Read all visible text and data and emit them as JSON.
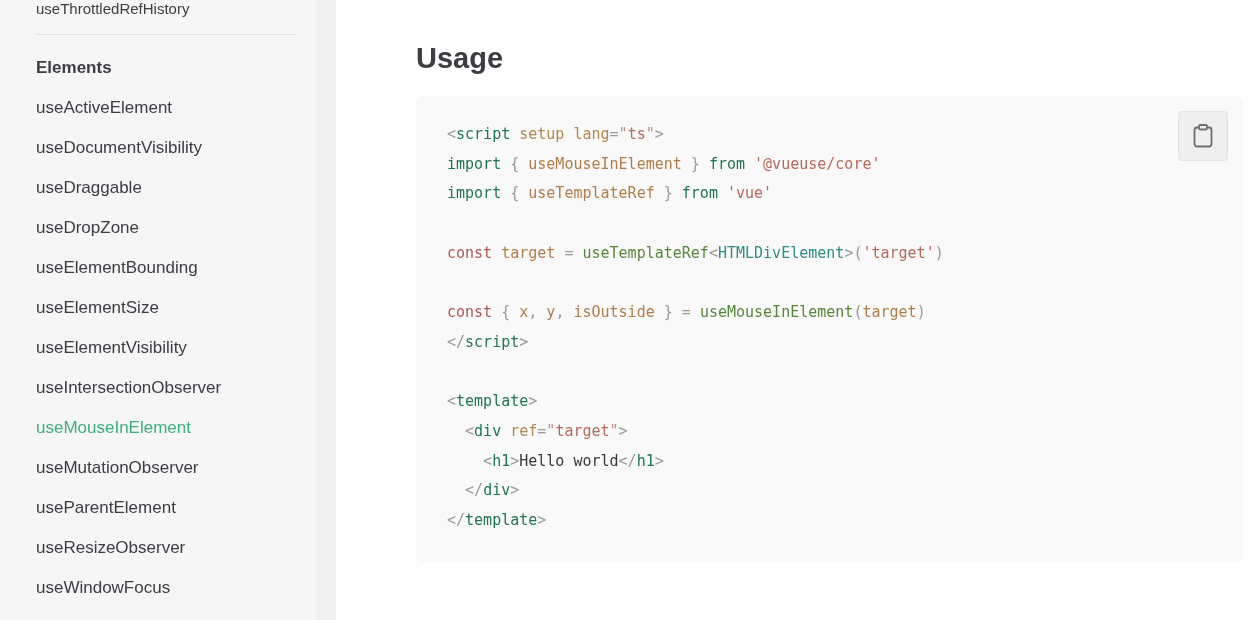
{
  "sidebar": {
    "cut_item": "useThrottledRefHistory",
    "section": {
      "title": "Elements",
      "items": [
        {
          "label": "useActiveElement",
          "selected": false
        },
        {
          "label": "useDocumentVisibility",
          "selected": false
        },
        {
          "label": "useDraggable",
          "selected": false
        },
        {
          "label": "useDropZone",
          "selected": false
        },
        {
          "label": "useElementBounding",
          "selected": false
        },
        {
          "label": "useElementSize",
          "selected": false
        },
        {
          "label": "useElementVisibility",
          "selected": false
        },
        {
          "label": "useIntersectionObserver",
          "selected": false
        },
        {
          "label": "useMouseInElement",
          "selected": true
        },
        {
          "label": "useMutationObserver",
          "selected": false
        },
        {
          "label": "useParentElement",
          "selected": false
        },
        {
          "label": "useResizeObserver",
          "selected": false
        },
        {
          "label": "useWindowFocus",
          "selected": false
        }
      ]
    }
  },
  "main": {
    "heading": "Usage",
    "code": {
      "blocks": [
        [
          [
            {
              "text": "<",
              "color": "#999999"
            },
            {
              "text": "script",
              "color": "#1e754f"
            },
            {
              "text": " setup lang",
              "color": "#b0884f"
            },
            {
              "text": "=",
              "color": "#999999"
            },
            {
              "text": "\"",
              "color": "#c48d80"
            },
            {
              "text": "ts",
              "color": "#b56959"
            },
            {
              "text": "\"",
              "color": "#c48d80"
            },
            {
              "text": ">",
              "color": "#999999"
            }
          ],
          [
            {
              "text": "import",
              "color": "#1e754f"
            },
            {
              "text": " { ",
              "color": "#999999"
            },
            {
              "text": "useMouseInElement",
              "color": "#b07d48"
            },
            {
              "text": " } ",
              "color": "#999999"
            },
            {
              "text": "from ",
              "color": "#1e754f"
            },
            {
              "text": "'@vueuse/core'",
              "color": "#b56959"
            }
          ],
          [
            {
              "text": "import",
              "color": "#1e754f"
            },
            {
              "text": " { ",
              "color": "#999999"
            },
            {
              "text": "useTemplateRef",
              "color": "#b07d48"
            },
            {
              "text": " } ",
              "color": "#999999"
            },
            {
              "text": "from ",
              "color": "#1e754f"
            },
            {
              "text": "'vue'",
              "color": "#b56959"
            }
          ]
        ],
        [
          [
            {
              "text": "const",
              "color": "#ab5959"
            },
            {
              "text": " target",
              "color": "#b07d48"
            },
            {
              "text": " = ",
              "color": "#999999"
            },
            {
              "text": "useTemplateRef",
              "color": "#59873a"
            },
            {
              "text": "<",
              "color": "#999999"
            },
            {
              "text": "HTMLDivElement",
              "color": "#2e8f82"
            },
            {
              "text": ">(",
              "color": "#999999"
            },
            {
              "text": "'target'",
              "color": "#b56959"
            },
            {
              "text": ")",
              "color": "#999999"
            }
          ]
        ],
        [
          [
            {
              "text": "const",
              "color": "#ab5959"
            },
            {
              "text": " { ",
              "color": "#999999"
            },
            {
              "text": "x",
              "color": "#b07d48"
            },
            {
              "text": ", ",
              "color": "#999999"
            },
            {
              "text": "y",
              "color": "#b07d48"
            },
            {
              "text": ", ",
              "color": "#999999"
            },
            {
              "text": "isOutside",
              "color": "#b07d48"
            },
            {
              "text": " } = ",
              "color": "#999999"
            },
            {
              "text": "useMouseInElement",
              "color": "#59873a"
            },
            {
              "text": "(",
              "color": "#999999"
            },
            {
              "text": "target",
              "color": "#b07d48"
            },
            {
              "text": ")",
              "color": "#999999"
            }
          ],
          [
            {
              "text": "</",
              "color": "#999999"
            },
            {
              "text": "script",
              "color": "#1e754f"
            },
            {
              "text": ">",
              "color": "#999999"
            }
          ]
        ],
        [
          [
            {
              "text": "<",
              "color": "#999999"
            },
            {
              "text": "template",
              "color": "#1e754f"
            },
            {
              "text": ">",
              "color": "#999999"
            }
          ],
          [
            {
              "text": "  <",
              "color": "#999999"
            },
            {
              "text": "div",
              "color": "#1e754f"
            },
            {
              "text": " ref",
              "color": "#b0884f"
            },
            {
              "text": "=",
              "color": "#999999"
            },
            {
              "text": "\"",
              "color": "#c48d80"
            },
            {
              "text": "target",
              "color": "#b56959"
            },
            {
              "text": "\"",
              "color": "#c48d80"
            },
            {
              "text": ">",
              "color": "#999999"
            }
          ],
          [
            {
              "text": "    <",
              "color": "#999999"
            },
            {
              "text": "h1",
              "color": "#1e754f"
            },
            {
              "text": ">",
              "color": "#999999"
            },
            {
              "text": "Hello world",
              "color": "#393a34"
            },
            {
              "text": "</",
              "color": "#999999"
            },
            {
              "text": "h1",
              "color": "#1e754f"
            },
            {
              "text": ">",
              "color": "#999999"
            }
          ],
          [
            {
              "text": "  </",
              "color": "#999999"
            },
            {
              "text": "div",
              "color": "#1e754f"
            },
            {
              "text": ">",
              "color": "#999999"
            }
          ],
          [
            {
              "text": "</",
              "color": "#999999"
            },
            {
              "text": "template",
              "color": "#1e754f"
            },
            {
              "text": ">",
              "color": "#999999"
            }
          ]
        ]
      ]
    }
  }
}
